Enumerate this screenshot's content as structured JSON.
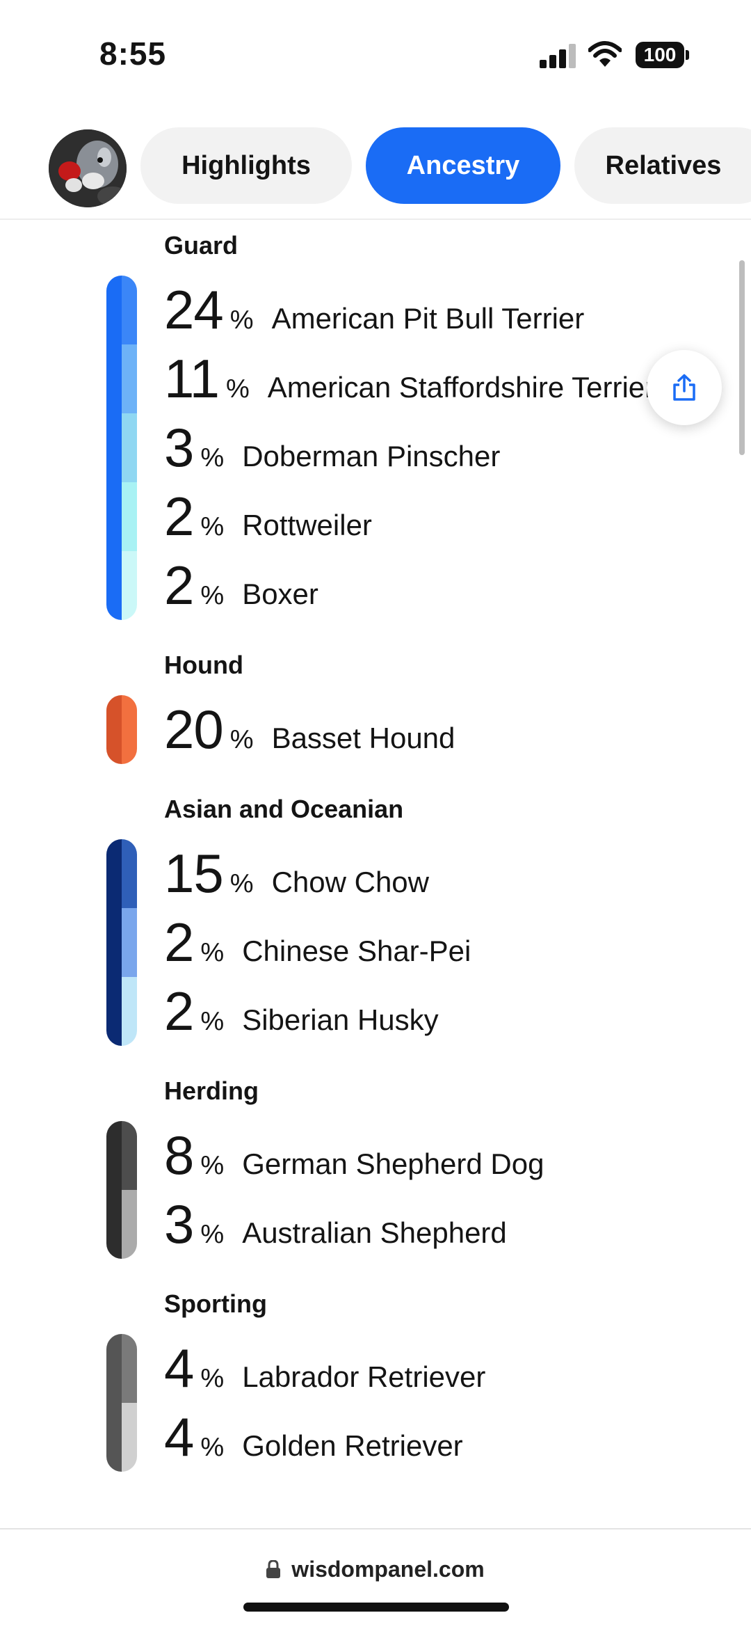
{
  "status_bar": {
    "time": "8:55",
    "battery": "100",
    "icons": [
      "signal-icon",
      "wifi-icon",
      "battery-icon"
    ]
  },
  "tabs": [
    {
      "label": "Highlights",
      "active": false
    },
    {
      "label": "Ancestry",
      "active": true
    },
    {
      "label": "Relatives",
      "active": false
    }
  ],
  "groups": [
    {
      "title": "Guard",
      "colors": [
        [
          "#1a6cf5",
          "#3b86f7"
        ],
        [
          "#1a6cf5",
          "#6db2f7"
        ],
        [
          "#1a6cf5",
          "#8fd7f2"
        ],
        [
          "#1a6cf5",
          "#a8f2f4"
        ],
        [
          "#1a6cf5",
          "#cbf8f8"
        ]
      ],
      "breeds": [
        {
          "pct": "24",
          "name": "American Pit Bull Terrier"
        },
        {
          "pct": "11",
          "name": "American Staffordshire Terrier"
        },
        {
          "pct": "3",
          "name": "Doberman Pinscher"
        },
        {
          "pct": "2",
          "name": "Rottweiler"
        },
        {
          "pct": "2",
          "name": "Boxer"
        }
      ]
    },
    {
      "title": "Hound",
      "colors": [
        [
          "#d6522a",
          "#f2703f"
        ]
      ],
      "breeds": [
        {
          "pct": "20",
          "name": "Basset Hound"
        }
      ]
    },
    {
      "title": "Asian and Oceanian",
      "colors": [
        [
          "#0b2a73",
          "#2f5fb8"
        ],
        [
          "#0b2a73",
          "#7aa6ec"
        ],
        [
          "#0b2a73",
          "#bfe6f8"
        ]
      ],
      "breeds": [
        {
          "pct": "15",
          "name": "Chow Chow"
        },
        {
          "pct": "2",
          "name": "Chinese Shar-Pei"
        },
        {
          "pct": "2",
          "name": "Siberian Husky"
        }
      ]
    },
    {
      "title": "Herding",
      "colors": [
        [
          "#2d2d2d",
          "#4d4d4d"
        ],
        [
          "#2d2d2d",
          "#ababab"
        ]
      ],
      "breeds": [
        {
          "pct": "8",
          "name": "German Shepherd Dog"
        },
        {
          "pct": "3",
          "name": "Australian Shepherd"
        }
      ]
    },
    {
      "title": "Sporting",
      "colors": [
        [
          "#555555",
          "#7a7a7a"
        ],
        [
          "#555555",
          "#d0d0d0"
        ]
      ],
      "breeds": [
        {
          "pct": "4",
          "name": "Labrador Retriever"
        },
        {
          "pct": "4",
          "name": "Golden Retriever"
        }
      ]
    }
  ],
  "percent_sign": "%",
  "share_button": {
    "icon": "share-icon"
  },
  "url": "wisdompanel.com",
  "accent_color": "#1a6cf5"
}
